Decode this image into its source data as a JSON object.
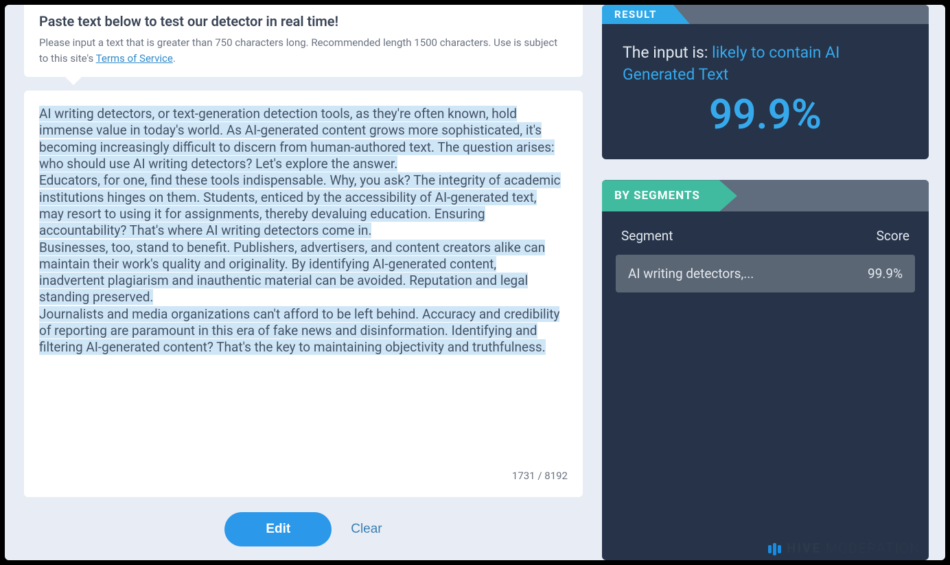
{
  "intro": {
    "title": "Paste text below to test our detector in real time!",
    "desc_prefix": "Please input a text that is greater than 750 characters long. Recommended length 1500 characters. Use is subject to this site's ",
    "tos_link_text": "Terms of Service",
    "desc_suffix": "."
  },
  "input": {
    "text": "AI writing detectors, or text-generation detection tools, as they're often known, hold immense value in today's world. As AI-generated content grows more sophisticated, it's becoming increasingly difficult to discern from human-authored text. The question arises: who should use AI writing detectors? Let's explore the answer.\nEducators, for one, find these tools indispensable. Why, you ask? The integrity of academic institutions hinges on them. Students, enticed by the accessibility of AI-generated text, may resort to using it for assignments, thereby devaluing education. Ensuring accountability? That's where AI writing detectors come in.\nBusinesses, too, stand to benefit. Publishers, advertisers, and content creators alike can maintain their work's quality and originality. By identifying AI-generated content, inadvertent plagiarism and inauthentic material can be avoided. Reputation and legal standing preserved.\nJournalists and media organizations can't afford to be left behind. Accuracy and credibility of reporting are paramount in this era of fake news and disinformation. Identifying and filtering AI-generated content? That's the key to maintaining objectivity and truthfulness.",
    "count_current": "1731",
    "count_separator": " / ",
    "count_max": "8192"
  },
  "buttons": {
    "edit": "Edit",
    "clear": "Clear"
  },
  "result": {
    "tab": "RESULT",
    "prefix": "The input is: ",
    "classification": "likely to contain AI Generated Text",
    "percentage": "99.9%"
  },
  "segments": {
    "tab": "BY SEGMENTS",
    "col_segment": "Segment",
    "col_score": "Score",
    "rows": [
      {
        "label": "AI writing detectors,...",
        "score": "99.9%"
      }
    ]
  },
  "footer": {
    "brand_bold": "HIVE",
    "brand_light": "MODERATION"
  }
}
